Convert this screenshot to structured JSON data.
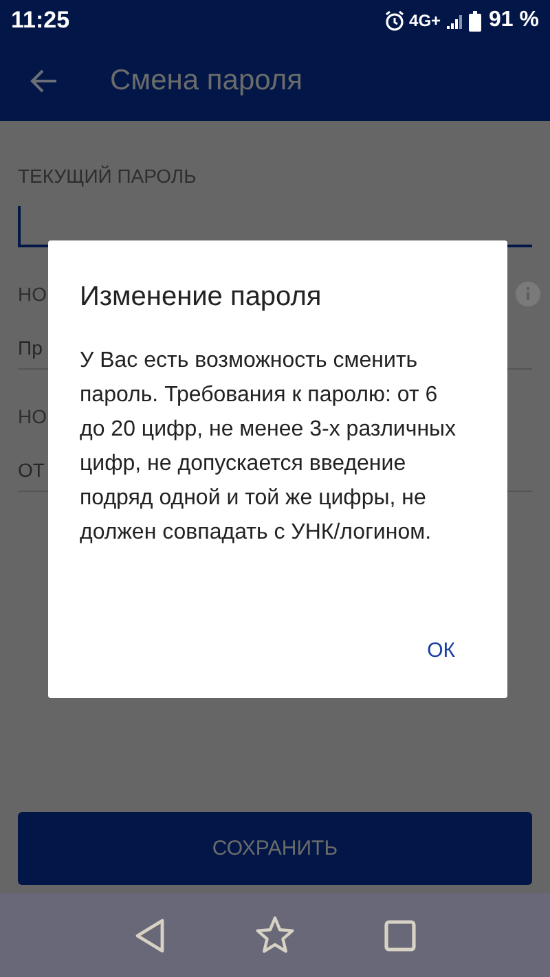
{
  "status_bar": {
    "time": "11:25",
    "network": "4G+",
    "battery": "91 %"
  },
  "app_bar": {
    "title": "Смена пароля"
  },
  "form": [
    {
      "kind": "label",
      "text": "ТЕКУЩИЙ ПАРОЛЬ",
      "info": false
    },
    {
      "kind": "input",
      "focused": true
    },
    {
      "kind": "label",
      "text": "НО",
      "info": true
    },
    {
      "kind": "input",
      "placeholder": "Пр",
      "focused": false
    },
    {
      "kind": "label",
      "text": "НО",
      "info": false
    },
    {
      "kind": "input",
      "placeholder": "ОТ",
      "focused": false
    }
  ],
  "save_button": "СОХРАНИТЬ",
  "dialog": {
    "title": "Изменение пароля",
    "message": "У Вас есть возможность сменить пароль. Требования к паролю: от 6 до 20 цифр, не менее 3-х различных цифр, не допускается введение подряд одной и той же цифры, не должен совпадать с УНК/логином.",
    "button": "ОК"
  }
}
